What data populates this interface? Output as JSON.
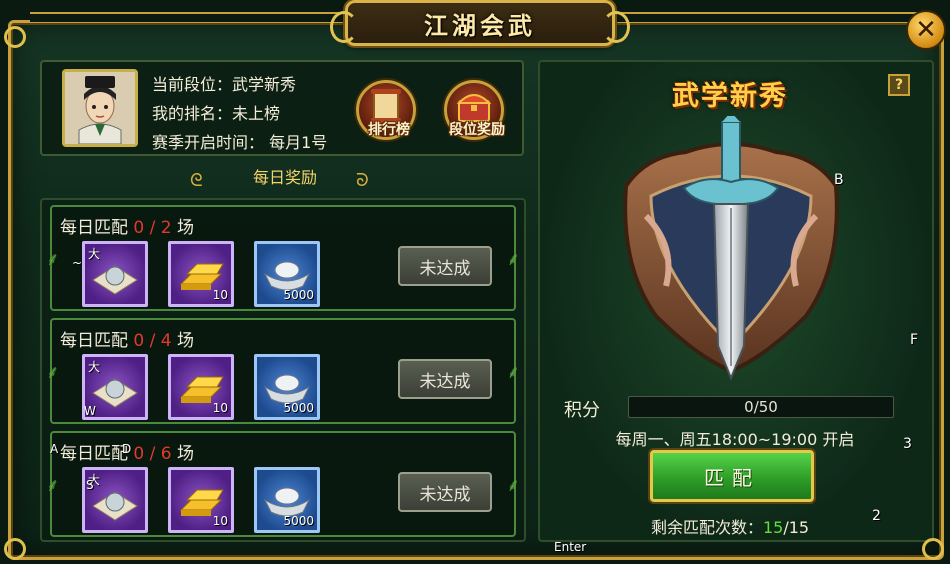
{
  "window": {
    "title": "江湖会武",
    "close_icon": "close-icon"
  },
  "profile": {
    "rank_line": "当前段位：武学新秀",
    "my_rank_line": "我的排名：未上榜",
    "season_line": "赛季开启时间： 每月1号",
    "buttons": [
      {
        "label": "排行榜",
        "icon": "scroll-icon"
      },
      {
        "label": "段位奖励",
        "icon": "treasure-chest-icon"
      }
    ]
  },
  "daily": {
    "title": "每日奖励",
    "rows": [
      {
        "label": "每日匹配",
        "done": "0",
        "sep": "/",
        "total": "2",
        "unit": "场",
        "items": [
          {
            "icon": "pearl-item-icon",
            "tag": "大",
            "qty": ""
          },
          {
            "icon": "gold-ingot-icon",
            "tag": "",
            "qty": "10"
          },
          {
            "icon": "silver-ingot-icon",
            "tag": "",
            "qty": "5000"
          }
        ],
        "status": "未达成"
      },
      {
        "label": "每日匹配",
        "done": "0",
        "sep": "/",
        "total": "4",
        "unit": "场",
        "items": [
          {
            "icon": "pearl-item-icon",
            "tag": "大",
            "qty": ""
          },
          {
            "icon": "gold-ingot-icon",
            "tag": "",
            "qty": "10"
          },
          {
            "icon": "silver-ingot-icon",
            "tag": "",
            "qty": "5000"
          }
        ],
        "status": "未达成"
      },
      {
        "label": "每日匹配",
        "done": "0",
        "sep": "/",
        "total": "6",
        "unit": "场",
        "items": [
          {
            "icon": "pearl-item-icon",
            "tag": "大",
            "qty": ""
          },
          {
            "icon": "gold-ingot-icon",
            "tag": "",
            "qty": "10"
          },
          {
            "icon": "silver-ingot-icon",
            "tag": "",
            "qty": "5000"
          }
        ],
        "status": "未达成"
      }
    ]
  },
  "rank_panel": {
    "rank_name": "武学新秀",
    "help": "?",
    "emblem_icon": "sword-shield-emblem-icon",
    "score_label": "积分",
    "score_text": "0/50",
    "score_fraction": 0,
    "schedule": "每周一、周五18:00~19:00  开启",
    "match_label": "匹配",
    "remaining_label": "剩余匹配次数：",
    "remaining_num": "15",
    "remaining_total": "/15"
  },
  "overlay_keys": {
    "b": "B",
    "f": "F",
    "three": "3",
    "two": "2",
    "enter": "Enter",
    "w": "W",
    "a": "A",
    "s": "S",
    "d": "D",
    "tilde": "~"
  },
  "colors": {
    "frame_gold": "#c9a13a",
    "count_red": "#e23a2a",
    "remaining_green": "#5fe03a",
    "match_green": "#3bb82f"
  }
}
